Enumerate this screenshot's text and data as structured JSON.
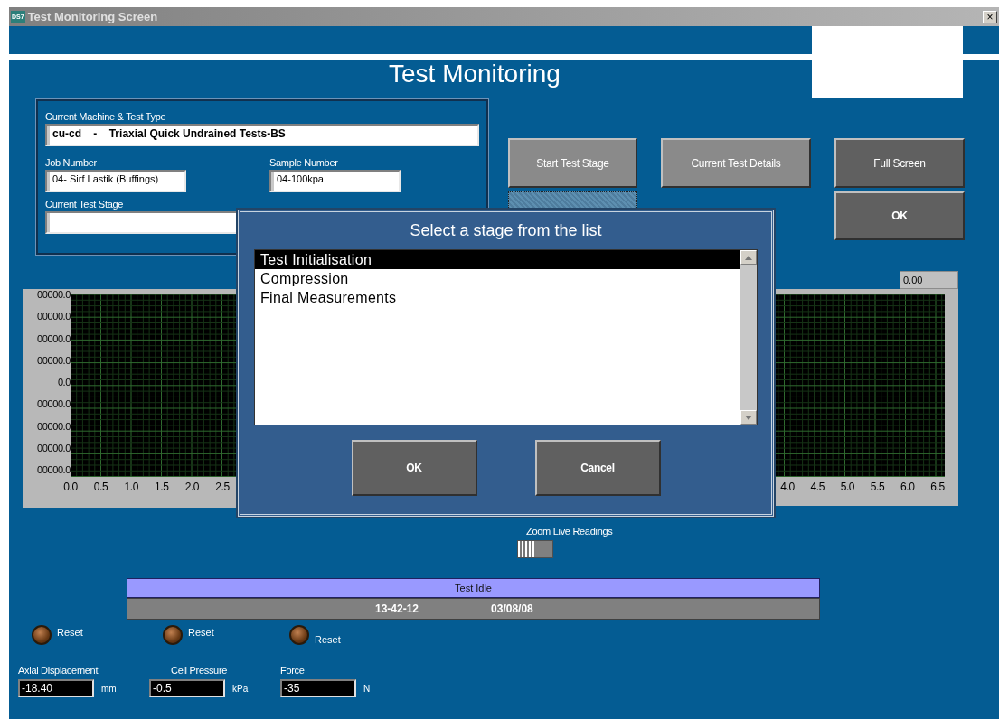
{
  "window": {
    "icon_text": "DS7",
    "title": "Test Monitoring Screen",
    "close": "×"
  },
  "header": {
    "title": "Test Monitoring"
  },
  "test_info": {
    "machine_label": "Current Machine & Test Type",
    "machine_code": "cu-cd",
    "machine_separator": "-",
    "machine_type": "Triaxial Quick Undrained Tests-BS",
    "job_label": "Job Number",
    "job_value": "04- Sirf Lastik (Buffings)",
    "sample_label": "Sample Number",
    "sample_value": "04-100kpa",
    "stage_label": "Current Test Stage"
  },
  "buttons": [
    {
      "label": "Start Test Stage",
      "kind": "light"
    },
    {
      "label": "Current Test Details",
      "kind": "light"
    },
    {
      "label": "Full Screen",
      "kind": "dark"
    },
    {
      "label": "OK",
      "kind": "dark"
    }
  ],
  "left_chart": {
    "y_ticks": [
      "00000.0",
      "00000.0",
      "00000.0",
      "00000.0",
      "0.0",
      "00000.0",
      "00000.0",
      "00000.0",
      "00000.0"
    ],
    "x_ticks": [
      "0.0",
      "0.5",
      "1.0",
      "1.5",
      "2.0",
      "2.5"
    ]
  },
  "right_chart": {
    "readout": "0.00",
    "x_ticks": [
      "4.0",
      "4.5",
      "5.0",
      "5.5",
      "6.0",
      "6.5"
    ]
  },
  "dialog": {
    "title": "Select a stage from the list",
    "items": [
      {
        "label": "Test Initialisation",
        "selected": true
      },
      {
        "label": "Compression",
        "selected": false
      },
      {
        "label": "Final Measurements",
        "selected": false
      }
    ],
    "buttons": [
      "OK",
      "Cancel"
    ]
  },
  "zoom": {
    "label": "Zoom Live Readings",
    "on": false
  },
  "status": {
    "state": "Test Idle",
    "time": "13-42-12",
    "date": "03/08/08"
  },
  "resets": [
    "Reset",
    "Reset",
    "Reset"
  ],
  "readings": [
    {
      "label": "Axial Displacement",
      "value": "-18.40",
      "unit": "mm"
    },
    {
      "label": "Cell Pressure",
      "value": "-0.5",
      "unit": "kPa"
    },
    {
      "label": "Force",
      "value": "-35",
      "unit": "N"
    }
  ]
}
